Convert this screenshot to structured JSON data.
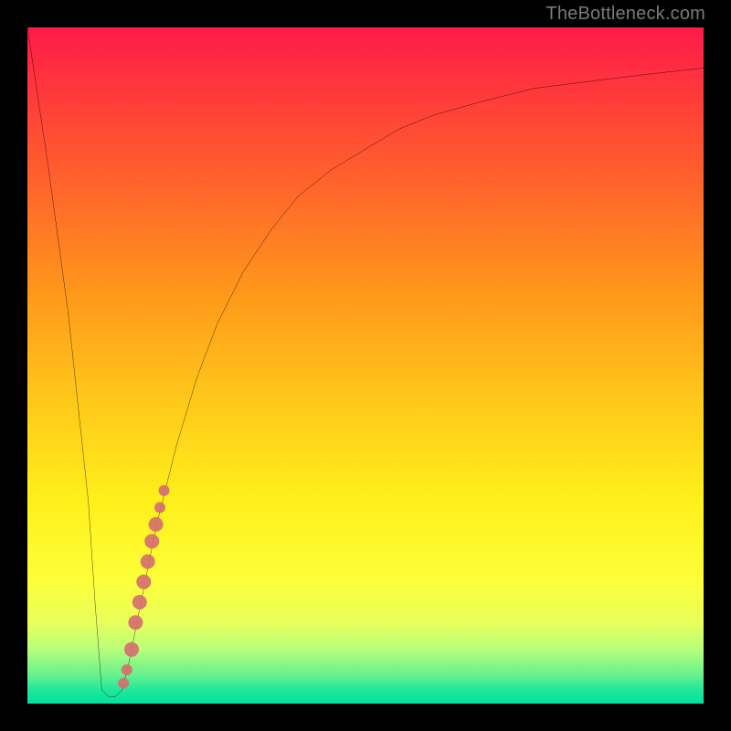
{
  "attribution": "TheBottleneck.com",
  "chart_data": {
    "type": "line",
    "title": "",
    "xlabel": "",
    "ylabel": "",
    "xlim": [
      0,
      100
    ],
    "ylim": [
      0,
      100
    ],
    "grid": false,
    "legend": false,
    "background_gradient": {
      "top_color": "#ff1a4a",
      "bottom_color": "#00e0a0",
      "meaning": "red=high bottleneck, green=low bottleneck"
    },
    "series": [
      {
        "name": "bottleneck-curve",
        "color": "#000000",
        "x": [
          0,
          3,
          6,
          9,
          10,
          11,
          12,
          13,
          14,
          15,
          17,
          19,
          22,
          25,
          28,
          32,
          36,
          40,
          45,
          50,
          55,
          60,
          67,
          75,
          83,
          91,
          100
        ],
        "y": [
          100,
          80,
          58,
          30,
          15,
          2,
          1,
          1,
          2,
          6,
          16,
          26,
          38,
          48,
          56,
          64,
          70,
          75,
          79,
          82,
          85,
          87,
          89,
          91,
          92,
          93,
          94
        ]
      }
    ],
    "highlight_points": {
      "name": "current-range-dots",
      "color": "#d66f70",
      "radius_main": 8,
      "radius_small": 6,
      "points": [
        {
          "x": 14.2,
          "y": 3
        },
        {
          "x": 14.7,
          "y": 5
        },
        {
          "x": 15.4,
          "y": 8
        },
        {
          "x": 16.0,
          "y": 12
        },
        {
          "x": 16.6,
          "y": 15
        },
        {
          "x": 17.2,
          "y": 18
        },
        {
          "x": 17.8,
          "y": 21
        },
        {
          "x": 18.4,
          "y": 24
        },
        {
          "x": 19.0,
          "y": 26.5
        },
        {
          "x": 19.6,
          "y": 29
        },
        {
          "x": 20.2,
          "y": 31.5
        }
      ]
    }
  }
}
